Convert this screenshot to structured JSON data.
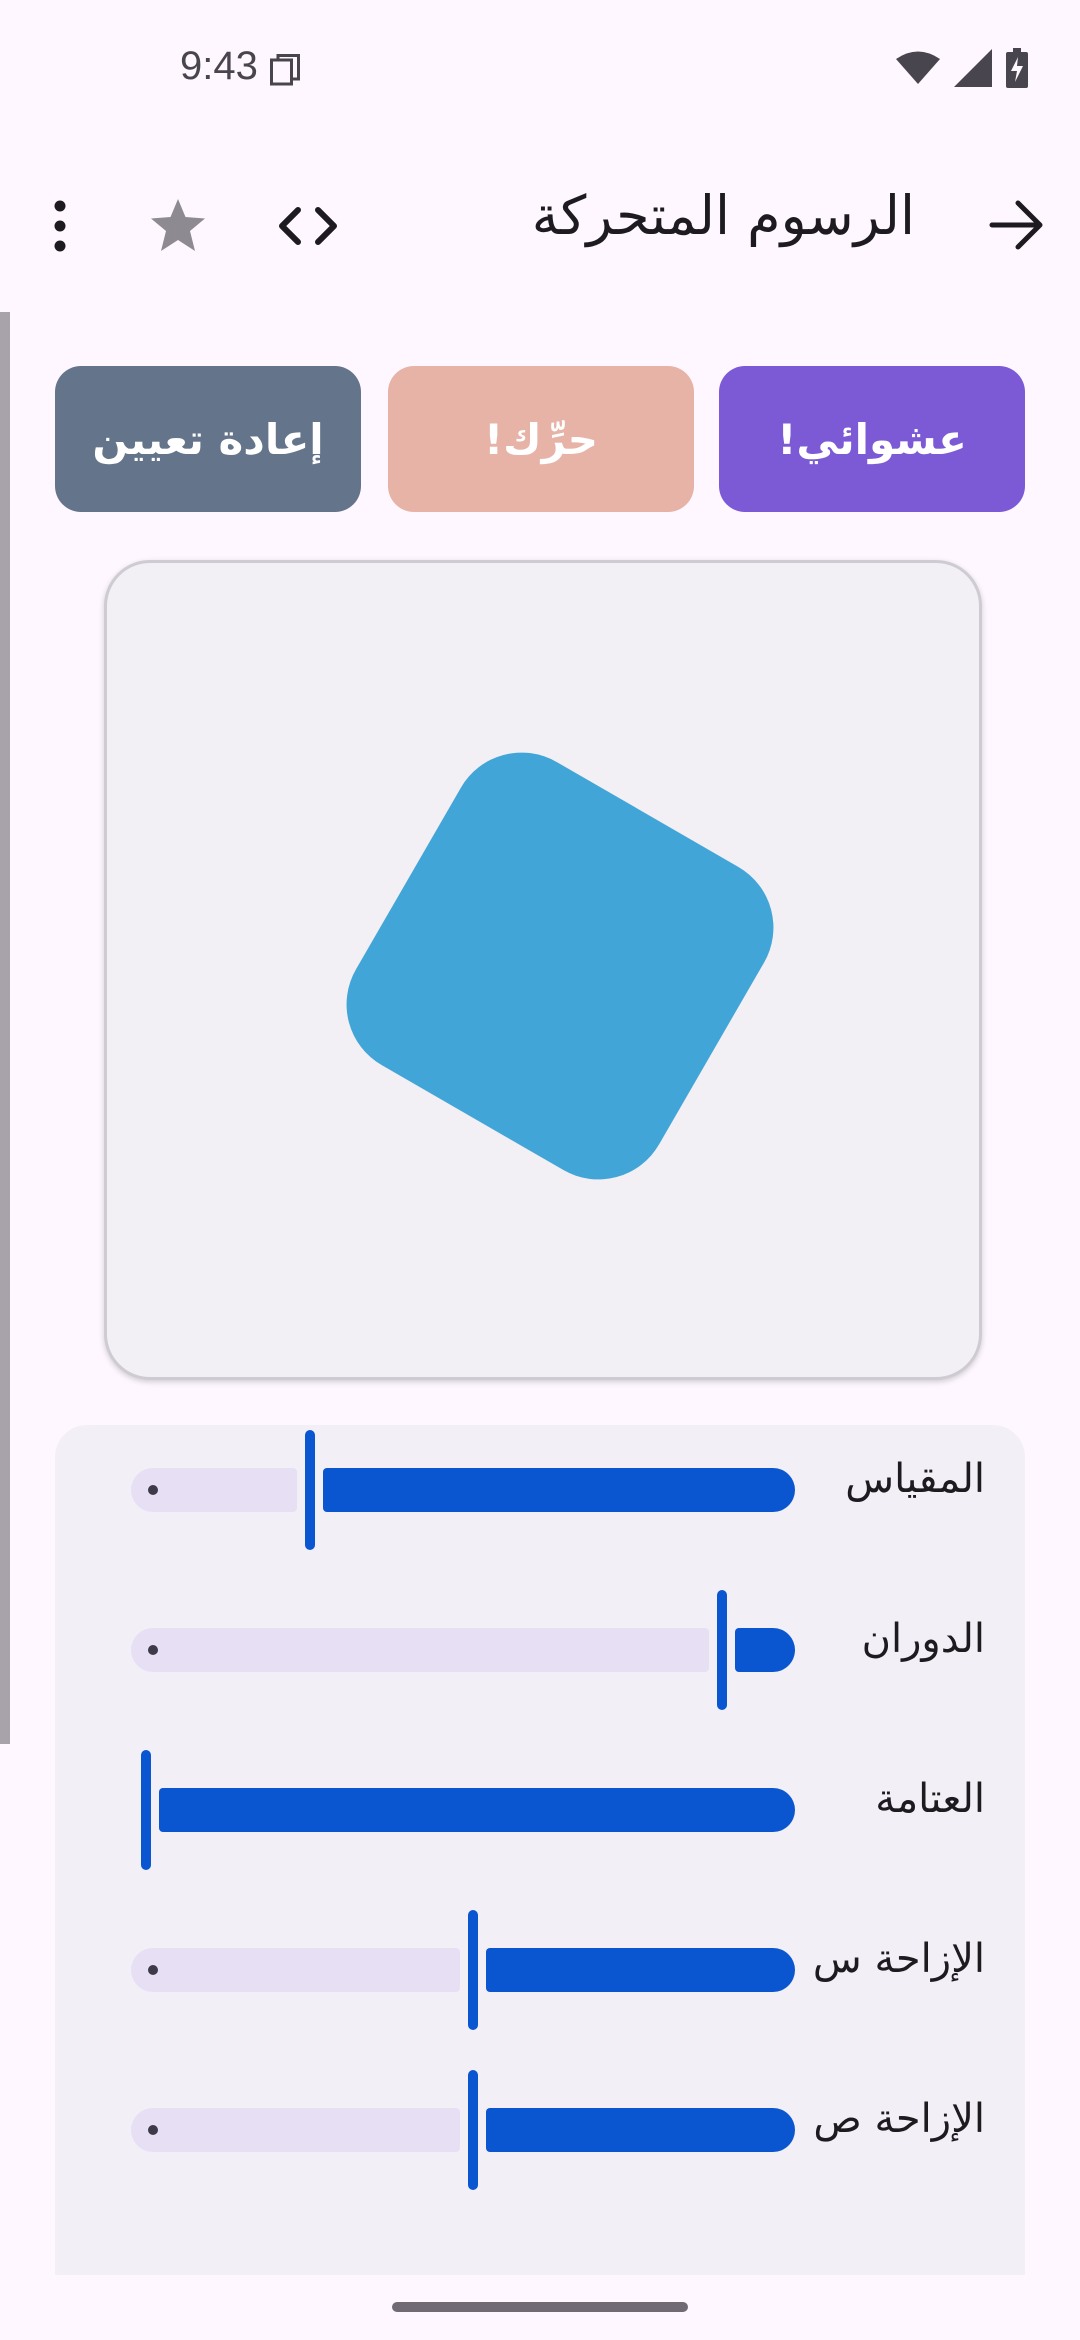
{
  "status_bar": {
    "time": "9:43",
    "icons": [
      "notification-copy-icon",
      "wifi-icon",
      "signal-icon",
      "battery-charging-icon"
    ]
  },
  "app_bar": {
    "title": "الرسوم المتحركة",
    "icons": [
      "back-arrow-icon",
      "code-icon",
      "star-icon",
      "more-vert-icon"
    ]
  },
  "buttons": {
    "random": "عشوائي!",
    "animate": "حرِّك!",
    "reset": "إعادة تعيين"
  },
  "colors": {
    "background": "#FEF7FF",
    "shape": "#42A5D7",
    "random_button": "#7C5AD6",
    "animate_button": "#E6B3A6",
    "reset_button": "#64748B",
    "slider_active": "#0A56D0",
    "slider_inactive": "#E7E0F5"
  },
  "sliders": [
    {
      "label": "المقياس",
      "value": 0.75
    },
    {
      "label": "الدوران",
      "value": 0.12
    },
    {
      "label": "العتامة",
      "value": 1.0
    },
    {
      "label": "الإزاحة س",
      "value": 0.5
    },
    {
      "label": "الإزاحة ص",
      "value": 0.5
    }
  ]
}
